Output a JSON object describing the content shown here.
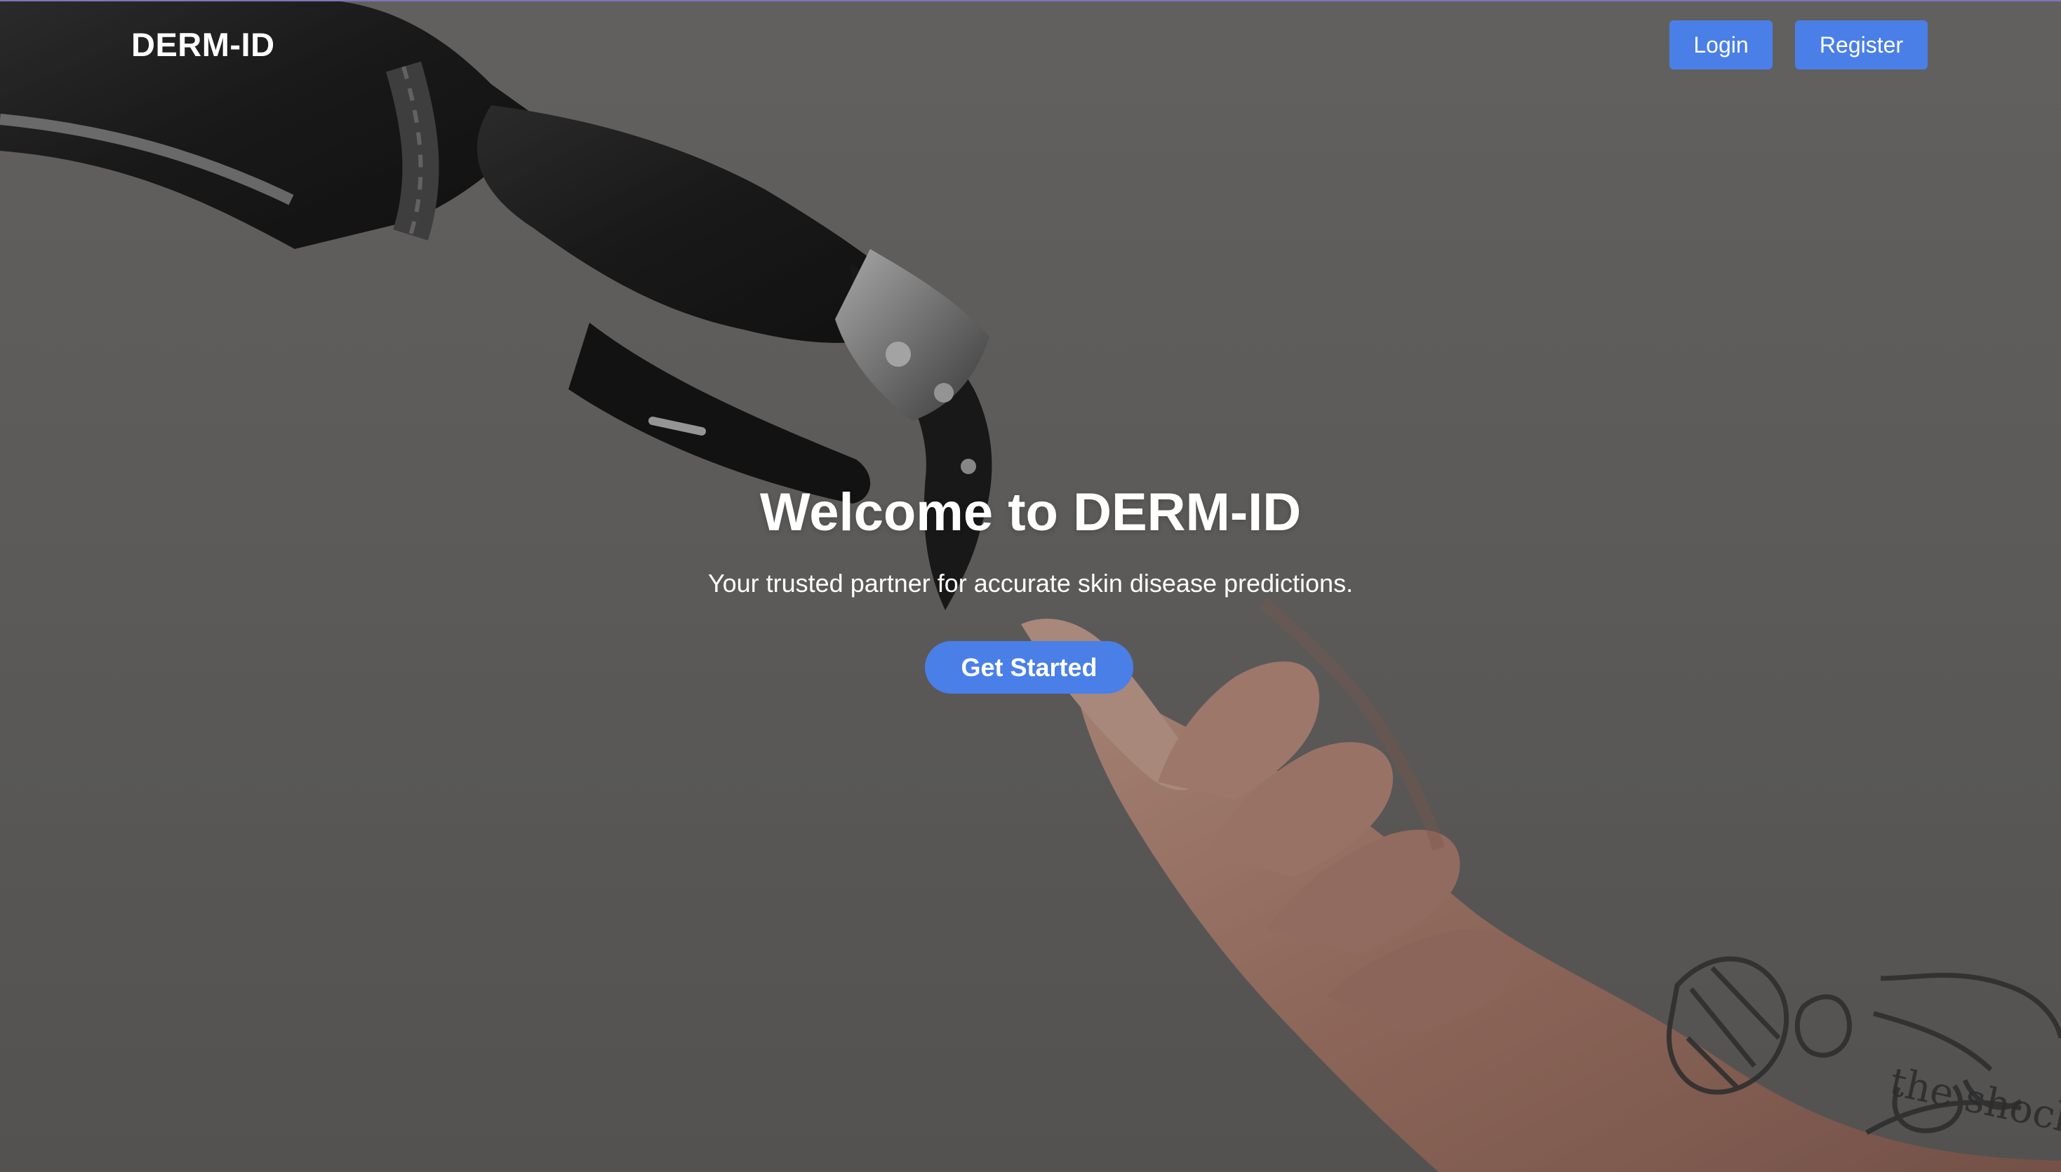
{
  "nav": {
    "brand": "DERM-ID",
    "login_label": "Login",
    "register_label": "Register"
  },
  "hero": {
    "title": "Welcome to DERM-ID",
    "subtitle": "Your trusted partner for accurate skin disease predictions.",
    "cta_label": "Get Started",
    "image_icon": "robot-human-hands-background-image",
    "tattoo_text": "the shocker"
  },
  "colors": {
    "accent": "#4a7fe8",
    "text": "#ffffff",
    "overlay": "#5f5e5c"
  }
}
